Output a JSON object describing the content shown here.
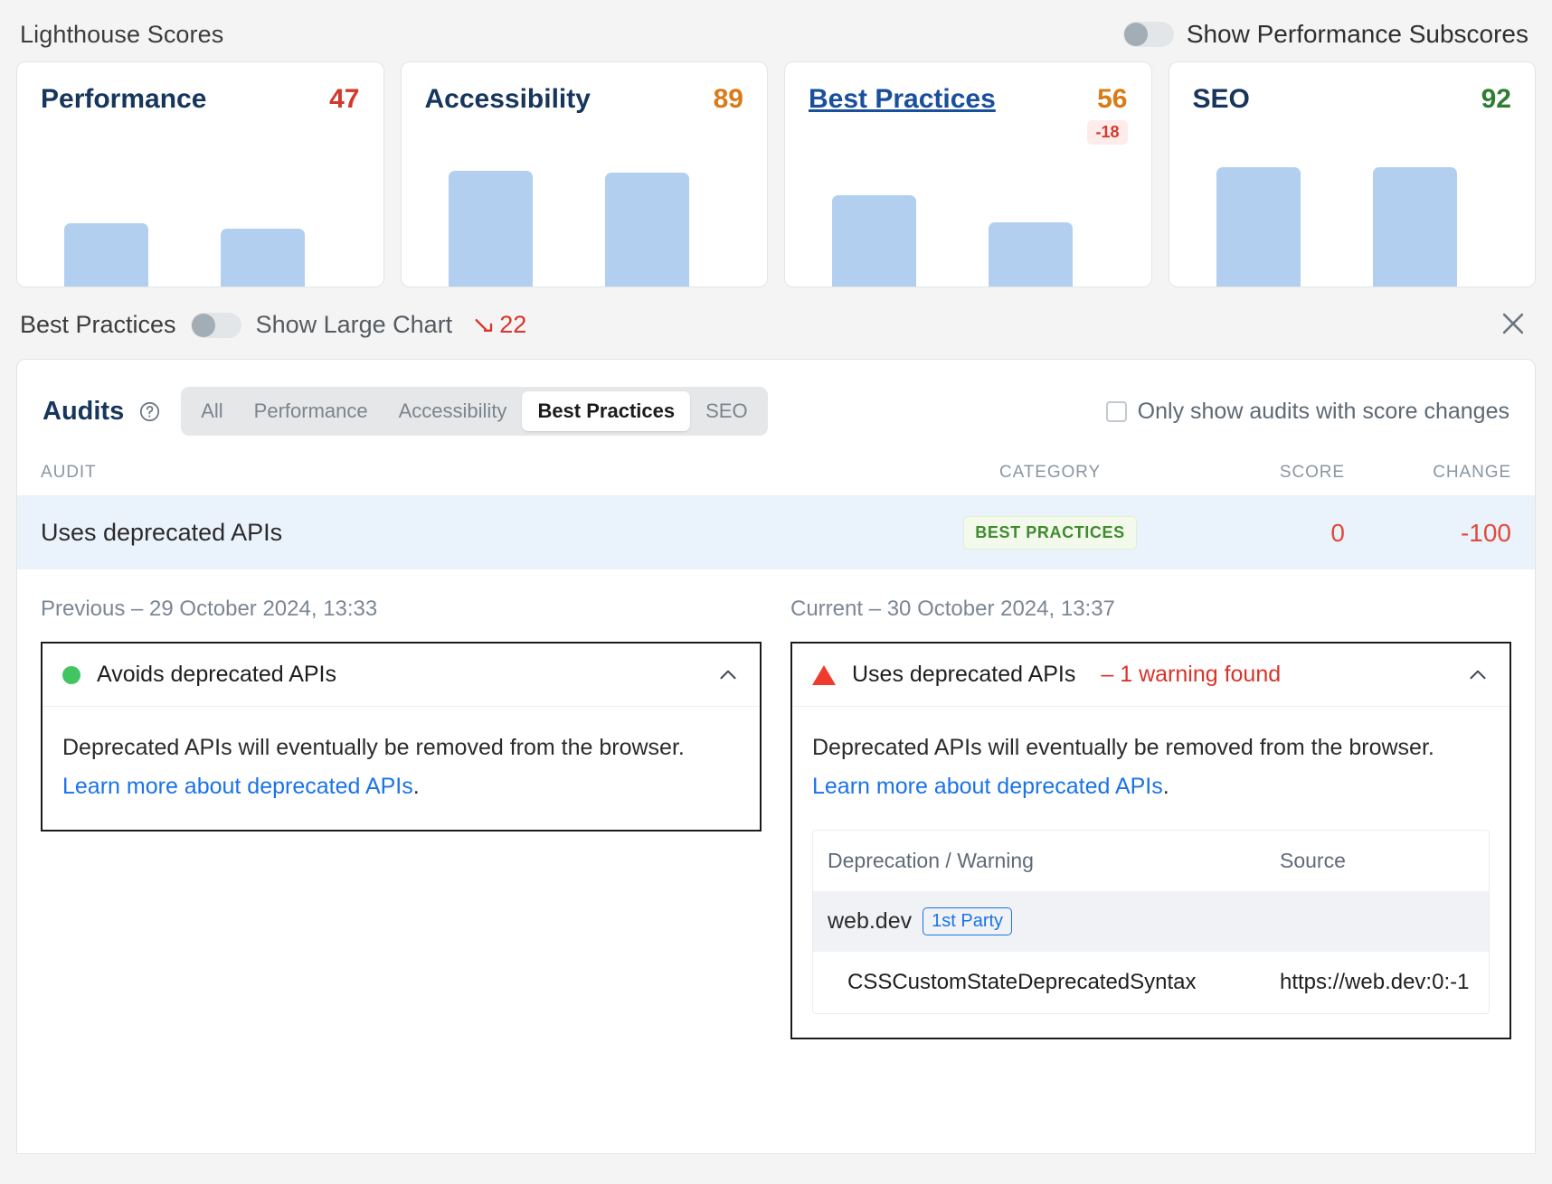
{
  "header": {
    "title": "Lighthouse Scores",
    "subscores_toggle_label": "Show Performance Subscores",
    "subscores_toggle_on": false
  },
  "cards": [
    {
      "name": "Performance",
      "score": "47",
      "score_color": "#d3392b",
      "linked": false,
      "delta": null,
      "bars": [
        47,
        44
      ]
    },
    {
      "name": "Accessibility",
      "score": "89",
      "score_color": "#d97b16",
      "linked": false,
      "delta": null,
      "bars": [
        89,
        88
      ]
    },
    {
      "name": "Best Practices",
      "score": "56",
      "score_color": "#d97b16",
      "linked": true,
      "delta": "-18",
      "bars": [
        74,
        56
      ]
    },
    {
      "name": "SEO",
      "score": "92",
      "score_color": "#2e7d32",
      "linked": false,
      "delta": null,
      "bars": [
        92,
        92
      ]
    }
  ],
  "section": {
    "title": "Best Practices",
    "large_chart_toggle_label": "Show Large Chart",
    "large_chart_toggle_on": false,
    "trend_value": "22",
    "trend_direction": "down",
    "close_label": "×"
  },
  "audits": {
    "title": "Audits",
    "help_icon": "question-circle-icon",
    "tabs": [
      {
        "label": "All",
        "active": false
      },
      {
        "label": "Performance",
        "active": false
      },
      {
        "label": "Accessibility",
        "active": false
      },
      {
        "label": "Best Practices",
        "active": true
      },
      {
        "label": "SEO",
        "active": false
      }
    ],
    "only_changes_label": "Only show audits with score changes",
    "only_changes_checked": false,
    "columns": {
      "audit": "AUDIT",
      "category": "CATEGORY",
      "score": "SCORE",
      "change": "CHANGE"
    },
    "row": {
      "audit": "Uses deprecated APIs",
      "category": "BEST PRACTICES",
      "score": "0",
      "change": "-100"
    }
  },
  "comparison": {
    "previous": {
      "stamp": "Previous – 29 October 2024, 13:33",
      "status": "pass",
      "heading": "Avoids deprecated APIs",
      "body_before_link": "Deprecated APIs will eventually be removed from the browser. ",
      "link_text": "Learn more about deprecated APIs",
      "body_after_link": "."
    },
    "current": {
      "stamp": "Current – 30 October 2024, 13:37",
      "status": "fail",
      "heading": "Uses deprecated APIs",
      "warning_text": "– 1 warning found",
      "body_before_link": "Deprecated APIs will eventually be removed from the browser. ",
      "link_text": "Learn more about deprecated APIs",
      "body_after_link": ".",
      "table": {
        "headers": {
          "c1": "Deprecation / Warning",
          "c2": "Source"
        },
        "group": {
          "name": "web.dev",
          "chip": "1st Party"
        },
        "rows": [
          {
            "c1": "CSSCustomStateDeprecatedSyntax",
            "c2": "https://web.dev:0:-1"
          }
        ]
      }
    }
  },
  "chart_data": {
    "type": "bar",
    "title": "Lighthouse Scores",
    "categories": [
      "Performance",
      "Accessibility",
      "Best Practices",
      "SEO"
    ],
    "series": [
      {
        "name": "Previous (29 October 2024, 13:33)",
        "values": [
          47,
          89,
          74,
          92
        ]
      },
      {
        "name": "Current (30 October 2024, 13:37)",
        "values": [
          44,
          88,
          56,
          92
        ]
      }
    ],
    "current_scores": [
      47,
      89,
      56,
      92
    ],
    "deltas": [
      null,
      null,
      -18,
      null
    ],
    "ylim": [
      0,
      100
    ],
    "ylabel": "Score",
    "xlabel": "",
    "grid": false,
    "legend": "none",
    "bar_color": "#b3cff0"
  }
}
